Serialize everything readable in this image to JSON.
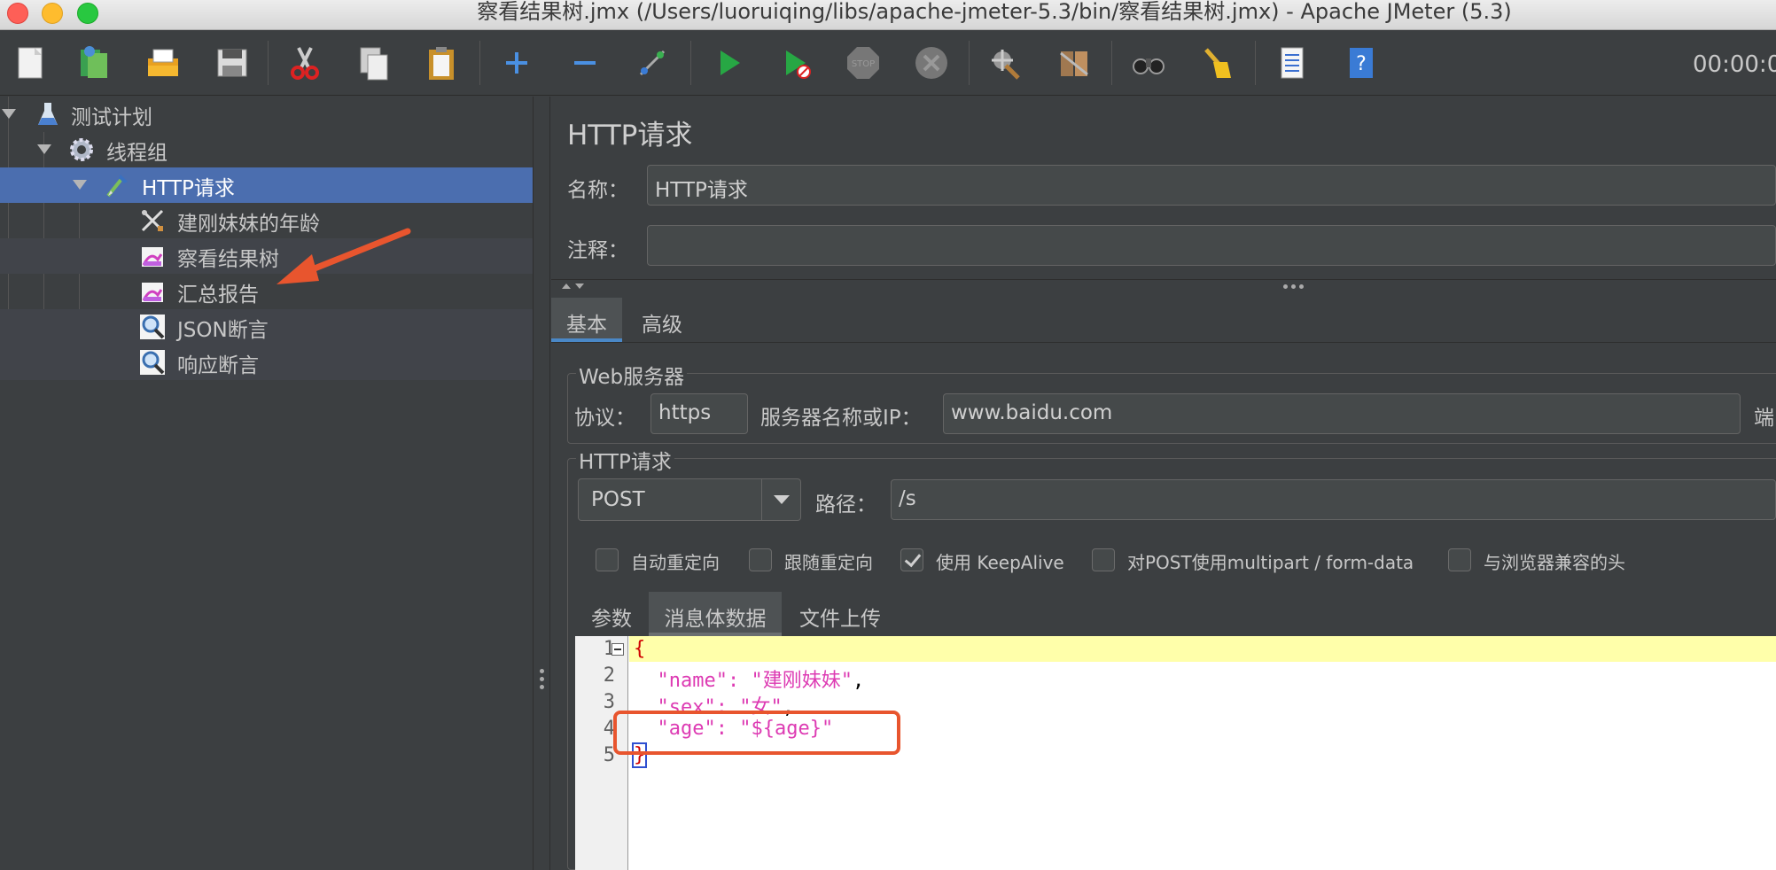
{
  "window": {
    "title": "察看结果树.jmx (/Users/luoruiqing/libs/apache-jmeter-5.3/bin/察看结果树.jmx) - Apache JMeter (5.3)"
  },
  "toolbar": {
    "buttons": [
      "new-icon",
      "templates-icon",
      "open-icon",
      "save-icon",
      "cut-icon",
      "copy-icon",
      "paste-icon",
      "expand-icon",
      "collapse-icon",
      "toggle-icon",
      "start-icon",
      "start-no-pause-icon",
      "stop-icon",
      "shutdown-icon",
      "clear-icon",
      "clear-all-icon",
      "search-icon",
      "reset-search-icon",
      "function-helper-icon",
      "help-icon"
    ],
    "timer": "00:00:0"
  },
  "tree": {
    "items": [
      {
        "label": "测试计划",
        "icon": "test-plan-icon"
      },
      {
        "label": "线程组",
        "icon": "thread-group-icon"
      },
      {
        "label": "HTTP请求",
        "icon": "http-sampler-icon",
        "selected": true
      },
      {
        "label": "建刚妹妹的年龄",
        "icon": "preprocessor-icon"
      },
      {
        "label": "察看结果树",
        "icon": "listener-icon"
      },
      {
        "label": "汇总报告",
        "icon": "listener-icon"
      },
      {
        "label": "JSON断言",
        "icon": "assertion-icon"
      },
      {
        "label": "响应断言",
        "icon": "assertion-icon"
      }
    ]
  },
  "panel": {
    "title": "HTTP请求",
    "name_label": "名称：",
    "name_value": "HTTP请求",
    "comment_label": "注释：",
    "comment_value": "",
    "tabs": [
      "基本",
      "高级"
    ],
    "web_server_title": "Web服务器",
    "protocol_label": "协议：",
    "protocol_value": "https",
    "server_label": "服务器名称或IP：",
    "server_value": "www.baidu.com",
    "port_label_partial": "端",
    "http_request_title": "HTTP请求",
    "method": "POST",
    "path_label": "路径：",
    "path_value": "/s",
    "checkboxes": [
      {
        "label": "自动重定向",
        "checked": false
      },
      {
        "label": "跟随重定向",
        "checked": false
      },
      {
        "label": "使用 KeepAlive",
        "checked": true
      },
      {
        "label": "对POST使用multipart / form-data",
        "checked": false
      },
      {
        "label": "与浏览器兼容的头",
        "checked": false
      }
    ],
    "subtabs": [
      "参数",
      "消息体数据",
      "文件上传"
    ],
    "active_subtab": "消息体数据"
  },
  "editor": {
    "line_numbers": [
      "1",
      "2",
      "3",
      "4",
      "5"
    ],
    "lines": [
      {
        "open_brace": "{"
      },
      {
        "key": "\"name\"",
        "colon": ": ",
        "value": "\"建刚妹妹\"",
        "comma": ","
      },
      {
        "key": "\"sex\"",
        "colon": ": ",
        "value": "\"女\"",
        "comma": ","
      },
      {
        "key": "\"age\"",
        "colon": ": ",
        "value": "\"${age}\"",
        "comma": ""
      },
      {
        "close_brace": "}"
      }
    ]
  },
  "colors": {
    "accent": "#4b6eaf",
    "annotation": "#e8552e",
    "json_string": "#dd3bb3",
    "current_line": "#ffffaa"
  }
}
